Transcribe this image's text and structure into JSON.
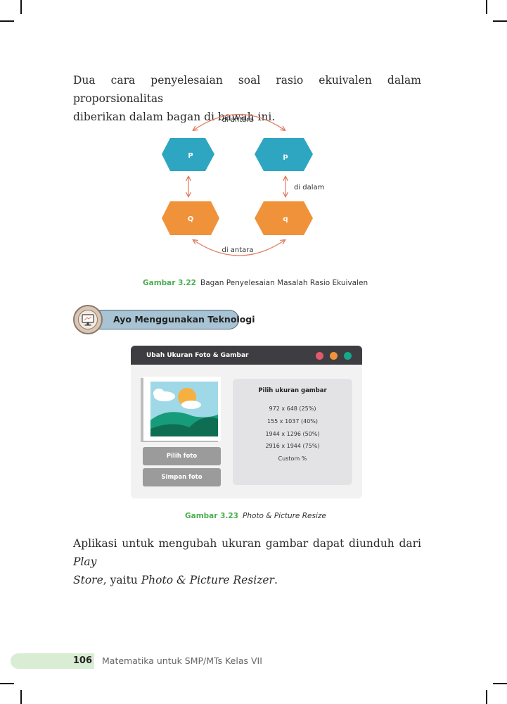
{
  "intro_paragraph": {
    "line1": "Dua cara penyelesaian soal rasio ekuivalen dalam proporsionalitas",
    "line2": "diberikan dalam bagan di bawah ini."
  },
  "diagram": {
    "top_arc_label": "di antara",
    "bottom_arc_label": "di antara",
    "right_arrow_label": "di dalam",
    "node_top_left": "P",
    "node_top_right": "p",
    "node_bottom_left": "Q",
    "node_bottom_right": "q",
    "colors": {
      "blue": "#2ea6c2",
      "orange": "#f0923a",
      "arrow": "#e07a5f"
    }
  },
  "figure_3_22": {
    "number": "Gambar 3.22",
    "text": "Bagan Penyelesaian Masalah Rasio Ekuivalen"
  },
  "tech_badge": {
    "label": "Ayo Menggunakan Teknologi",
    "icon": "computer-monitor-icon"
  },
  "app": {
    "title": "Ubah Ukuran Foto & Gambar",
    "window_dots": [
      "#e05a6b",
      "#f0923a",
      "#17a88a"
    ],
    "pick_photo_button": "Pilih foto",
    "save_photo_button": "Simpan foto",
    "size_heading": "Pilih ukuran gambar",
    "size_options": [
      "972 x 648 (25%)",
      "155 x 1037 (40%)",
      "1944 x 1296 (50%)",
      "2916 x 1944 (75%)",
      "Custom %"
    ]
  },
  "figure_3_23": {
    "number": "Gambar 3.23",
    "text": "Photo & Picture Resize"
  },
  "closing_paragraph": {
    "part1": "Aplikasi untuk mengubah ukuran gambar dapat diunduh dari ",
    "italic1": "Play",
    "italic2": "Store",
    "part2": ", yaitu ",
    "italic3": "Photo & Picture Resizer",
    "part3": "."
  },
  "footer": {
    "page_number": "106",
    "book_title": "Matematika untuk SMP/MTs Kelas VII"
  }
}
